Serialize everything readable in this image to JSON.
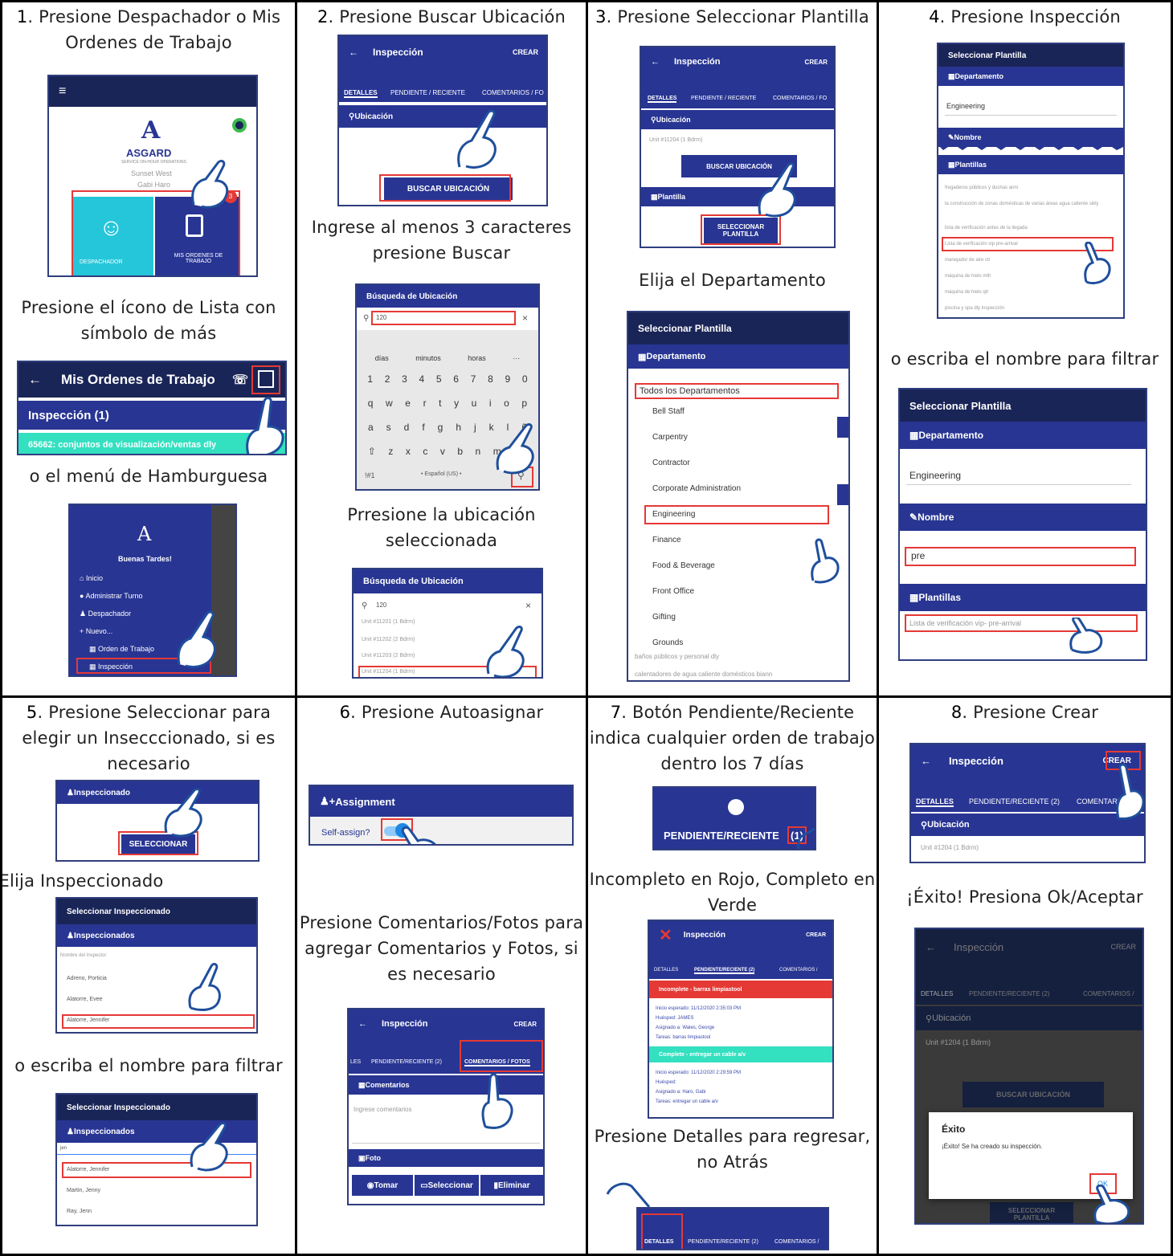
{
  "cells": [
    {
      "num": "1",
      "caption": ". Presione Despachador o Mis Ordenes de Trabajo",
      "home": {
        "brand": "ASGARD",
        "brand_sub": "SERVICE ON-HOUR OPERATIONS",
        "site": "Sunset West",
        "user": "Gabi Haro",
        "tile1": "DESPACHADOR",
        "tile2": "MIS ORDENES DE TRABAJO",
        "badge": "3"
      },
      "caption2": "Presione el ícono de Lista con símbolo de más",
      "wo": {
        "title": "Mis Ordenes de Trabajo",
        "section": "Inspección (1)",
        "row": "65662: conjuntos de visualización/ventas dly"
      },
      "caption3": "o el menú de Hamburguesa",
      "menu": {
        "greeting": "Buenas Tardes!",
        "items": [
          "Inicio",
          "Administrar Turno",
          "Despachador",
          "Nuevo...",
          "Orden de Trabajo",
          "Inspección"
        ]
      }
    },
    {
      "num": "2",
      "caption": ". Presione Buscar Ubicación",
      "screen": {
        "title": "Inspección",
        "action": "CREAR",
        "tabs": [
          "DETALLES",
          "PENDIENTE / RECIENTE",
          "COMENTARIOS / FO"
        ],
        "section": "Ubicación",
        "button": "BUSCAR UBICACIÓN"
      },
      "caption2": "Ingrese al menos 3 caracteres presione Buscar",
      "search": {
        "title": "Búsqueda de Ubicación",
        "value": "120",
        "suggest": [
          "días",
          "minutos",
          "horas",
          "···"
        ],
        "row1": [
          "1",
          "2",
          "3",
          "4",
          "5",
          "6",
          "7",
          "8",
          "9",
          "0"
        ],
        "row2": [
          "q",
          "w",
          "e",
          "r",
          "t",
          "y",
          "u",
          "i",
          "o",
          "p"
        ],
        "row3": [
          "a",
          "s",
          "d",
          "f",
          "g",
          "h",
          "j",
          "k",
          "l",
          "ñ"
        ],
        "row4": [
          "⇧",
          "z",
          "x",
          "c",
          "v",
          "b",
          "n",
          "m",
          "⌫"
        ],
        "sym": "!#1",
        "lang": "• Español (US) •"
      },
      "caption3": "Prresione la ubicación seleccionada",
      "results": {
        "title": "Búsqueda de Ubicación",
        "value": "120",
        "items": [
          "Unit #11201 (1 Bdrm)",
          "Unit #11202 (2 Bdrm)",
          "Unit #11203 (2 Bdrm)",
          "Unit #11204 (1 Bdrm)"
        ]
      }
    },
    {
      "num": "3",
      "caption": ". Presione Seleccionar Plantilla",
      "screen": {
        "title": "Inspección",
        "action": "CREAR",
        "tabs": [
          "DETALLES",
          "PENDIENTE / RECIENTE",
          "COMENTARIOS / FO"
        ],
        "section": "Ubicación",
        "unit": "Unit #11204 (1 Bdrm)",
        "button": "BUSCAR UBICACIÓN",
        "section2": "Plantilla",
        "button2": "SELECCIONAR PLANTILLA"
      },
      "caption2": "Elija el Departamento",
      "dept": {
        "title": "Seleccionar Plantilla",
        "section": "Departamento",
        "value": "Todos los Departamentos",
        "items": [
          "Bell Staff",
          "Carpentry",
          "Contractor",
          "Corporate Administration",
          "Engineering",
          "Finance",
          "Food & Beverage",
          "Front Office",
          "Gifting",
          "Grounds"
        ],
        "after": [
          "baños públicos y personal dly",
          "calentadores de agua caliente domésticos biann"
        ]
      }
    },
    {
      "num": "4",
      "caption": ". Presione Inspección",
      "tpl": {
        "title": "Seleccionar Plantilla",
        "section": "Departamento",
        "dept": "Engineering",
        "name_section": "Nombre",
        "templates_section": "Plantillas",
        "items": [
          "fregaderos públicos y duchas anni",
          "la construcción de zonas domésticas de varias áreas agua caliente sikly",
          "lista de verificación antes de la llegada",
          "Lista de verificación vip pre-arrival",
          "manejador de aire ctr",
          "máquina de hielo mth",
          "máquina de hielo qtr",
          "piscina y spa dly inspección"
        ]
      },
      "caption2": "o escriba el nombre para filtrar",
      "filter": {
        "title": "Seleccionar Plantilla",
        "section": "Departamento",
        "dept": "Engineering",
        "name_section": "Nombre",
        "name_value": "pre",
        "templates_section": "Plantillas",
        "item": "Lista de verificación vip- pre-arrival"
      }
    },
    {
      "num": "5",
      "caption": ". Presione Seleccionar para elegir un Insecccionado, si es necesario",
      "sel": {
        "section": "Inspeccionado",
        "button": "SELECCIONAR"
      },
      "caption2": "Elija Inspeccionado",
      "list": {
        "title": "Seleccionar Inspeccionado",
        "section": "Inspeccionados",
        "placeholder": "Nombre del Inspector",
        "items": [
          "Adreno, Porticia",
          "Alatorre, Evee",
          "Alatorre, Jennifer"
        ]
      },
      "caption3": "o escriba el nombre para filtrar",
      "list2": {
        "title": "Seleccionar Inspeccionado",
        "section": "Inspeccionados",
        "value": "jen",
        "items": [
          "Alatorre, Jennifer",
          "Martin, Jenny",
          "Ray, Jenn"
        ]
      }
    },
    {
      "num": "6",
      "caption": ". Presione Autoasignar",
      "assign": {
        "title": "Assignment",
        "label": "Self-assign?"
      },
      "caption2": "Presione Comentarios/Fotos para agregar Comentarios y Fotos, si es necesario",
      "comments": {
        "title": "Inspección",
        "action": "CREAR",
        "tabs": [
          "LES",
          "PENDIENTE/RECIENTE (2)",
          "COMENTARIOS / FOTOS"
        ],
        "section": "Comentarios",
        "placeholder": "Ingrese comentarios",
        "photo": "Foto",
        "buttons": [
          "Tomar",
          "Seleccionar",
          "Eliminar"
        ]
      }
    },
    {
      "num": "7",
      "caption": ". Botón Pendiente/Reciente indica cualquier orden de trabajo dentro los 7 días",
      "pend": {
        "label": "PENDIENTE/RECIENTE",
        "count": "(1)"
      },
      "caption2": "Incompleto en Rojo, Completo en Verde",
      "status": {
        "title": "Inspección",
        "action": "CREAR",
        "tabs": [
          "DETALLES",
          "PENDIENTE/RECIENTE (2)",
          "COMENTARIOS /"
        ],
        "incomplete": "Incomplete - barras limpiastool",
        "inc_lines": [
          "Inicio esperado: 11/12/2020 2:35:03 PM",
          "Huésped: JAMES",
          "Asignado a: Wales, George",
          "Tareas: barras limpiastool"
        ],
        "complete": "Complete - entregar un cable a/v",
        "com_lines": [
          "Inicio esperado: 11/12/2020 2:29:59 PM",
          "Huésped:",
          "Asignado a: Haro, Gabi",
          "Tareas: entregar un cable a/v"
        ]
      },
      "caption3": "Presione Detalles para regresar, no Atrás",
      "tabs": [
        "DETALLES",
        "PENDIENTE/RECIENTE (2)",
        "COMENTARIOS /"
      ]
    },
    {
      "num": "8",
      "caption": ". Presione Crear",
      "create": {
        "title": "Inspección",
        "action": "CREAR",
        "tabs": [
          "DETALLES",
          "PENDIENTE/RECIENTE (2)",
          "COMENTARIOS /"
        ],
        "section": "Ubicación",
        "unit": "Unit #1204 (1 Bdrm)"
      },
      "caption2": "¡Éxito! Presiona Ok/Aceptar",
      "success": {
        "title": "Inspección",
        "action": "CREAR",
        "tabs": [
          "DETALLES",
          "PENDIENTE/RECIENTE (2)",
          "COMENTARIOS /"
        ],
        "section": "Ubicación",
        "unit": "Unit #1204 (1 Bdrm)",
        "button": "BUSCAR UBICACIÓN",
        "dialog_title": "Éxito",
        "dialog_msg": "¡Éxito! Se ha creado su inspección.",
        "ok": "OK",
        "button2": "SELECCIONAR PLANTILLA"
      }
    }
  ],
  "colors": {
    "navy": "#283593",
    "dark": "#1a2557",
    "teal": "#26c6da",
    "green": "#33e0c0",
    "red": "#e53935",
    "hand": "#1f4f9c"
  }
}
